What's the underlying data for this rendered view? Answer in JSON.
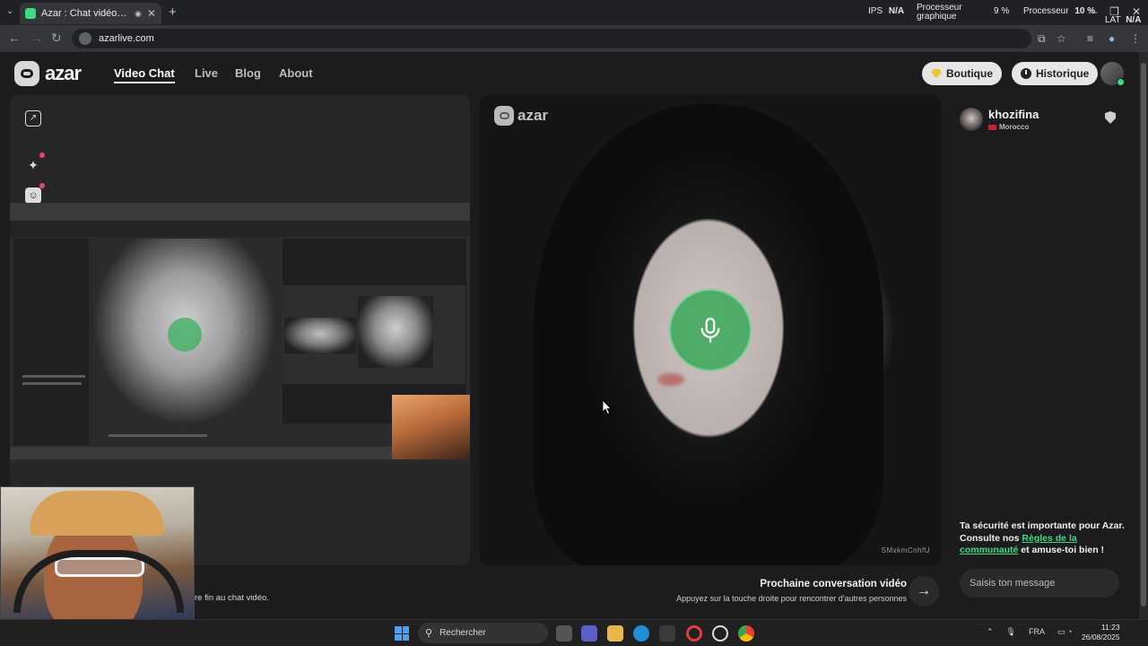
{
  "browser": {
    "tab_title": "Azar : Chat vidéo avec de n",
    "url": "azarlive.com",
    "new_tab": "+",
    "stats": {
      "ips_label": "IPS",
      "ips_value": "N/A",
      "gpu_label": "Processeur graphique",
      "gpu_value": "9 %",
      "cpu_label": "Processeur",
      "cpu_value": "10 %",
      "lat_label": "LAT",
      "lat_value": "N/A"
    }
  },
  "site": {
    "logo_text": "azar",
    "nav": [
      {
        "label": "Video Chat",
        "active": true
      },
      {
        "label": "Live"
      },
      {
        "label": "Blog"
      },
      {
        "label": "About"
      }
    ],
    "shop_label": "Boutique",
    "history_label": "Historique"
  },
  "remote": {
    "logo_text": "azar",
    "watermark": "SMxkmCnhfU"
  },
  "chat": {
    "partner_name": "khozifina",
    "partner_country": "Morocco",
    "safety_prefix": "Ta sécurité est importante pour Azar. Consulte nos ",
    "safety_link": "Règles de la communauté",
    "safety_suffix": " et amuse-toi bien !",
    "input_placeholder": "Saisis ton message"
  },
  "bottom": {
    "partial_text": "re fin au chat vidéo.",
    "next_title": "Prochaine conversation vidéo",
    "next_subtitle": "Appuyez sur la touche droite pour rencontrer d'autres personnes"
  },
  "taskbar": {
    "search_label": "Rechercher",
    "lang": "FRA",
    "time": "11:23",
    "date": "26/08/2025"
  },
  "colors": {
    "accent_green": "#3ddc84",
    "mic_green": "#3eaa5c",
    "background": "#1c1c1e"
  }
}
